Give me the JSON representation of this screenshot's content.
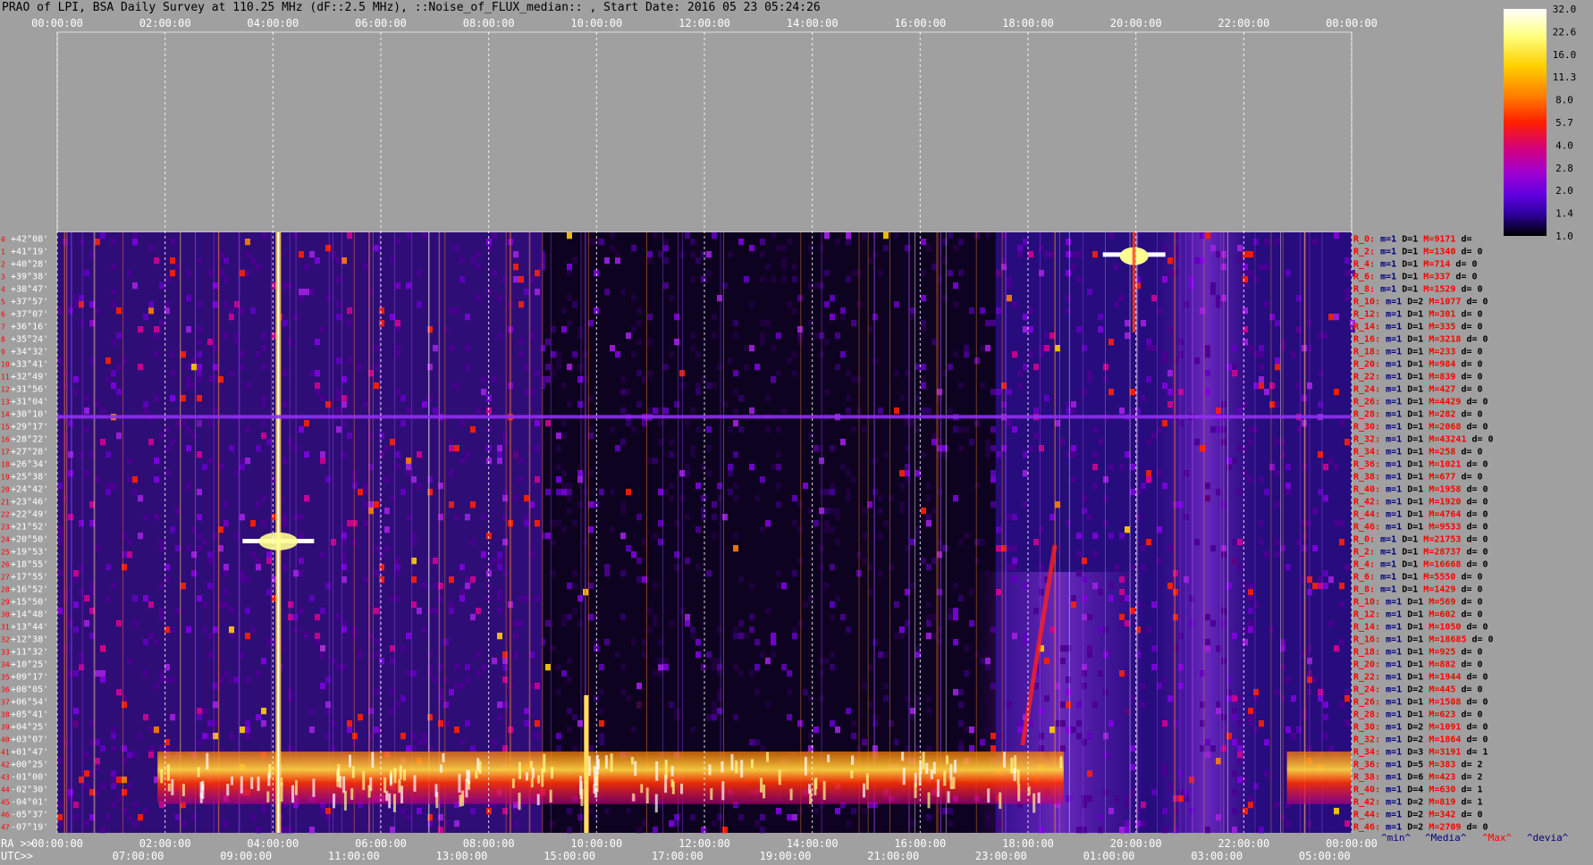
{
  "title": "PRAO of LPI, BSA Daily Survey at 110.25 MHz (dF::2.5 MHz), ::Noise_of_FLUX_median:: , Start Date: 2016 05 23 05:24:26",
  "chart_data": {
    "type": "heatmap",
    "title": "PRAO of LPI, BSA Daily Survey at 110.25 MHz (dF::2.5 MHz), ::Noise_of_FLUX_median:: , Start Date: 2016 05 23 05:24:26",
    "top_axis_ticks": [
      "00:00:00",
      "02:00:00",
      "04:00:00",
      "06:00:00",
      "08:00:00",
      "10:00:00",
      "12:00:00",
      "14:00:00",
      "16:00:00",
      "18:00:00",
      "20:00:00",
      "22:00:00",
      "00:00:00"
    ],
    "ra_prefix": "RA >>",
    "ra_ticks": [
      "00:00:00",
      "02:00:00",
      "04:00:00",
      "06:00:00",
      "08:00:00",
      "10:00:00",
      "12:00:00",
      "14:00:00",
      "16:00:00",
      "18:00:00",
      "20:00:00",
      "22:00:00",
      "00:00:00"
    ],
    "utc_prefix": "UTC>>",
    "utc_ticks": [
      "07:00:00",
      "09:00:00",
      "11:00:00",
      "13:00:00",
      "15:00:00",
      "17:00:00",
      "19:00:00",
      "21:00:00",
      "23:00:00",
      "01:00:00",
      "03:00:00",
      "05:00:00"
    ],
    "declinations": [
      "+42°08'",
      "+41°19'",
      "+40°28'",
      "+39°38'",
      "+38°47'",
      "+37°57'",
      "+37°07'",
      "+36°16'",
      "+35°24'",
      "+34°32'",
      "+33°41'",
      "+32°49'",
      "+31°56'",
      "+31°04'",
      "+30°10'",
      "+29°17'",
      "+28°22'",
      "+27°28'",
      "+26°34'",
      "+25°38'",
      "+24°42'",
      "+23°46'",
      "+22°49'",
      "+21°52'",
      "+20°50'",
      "+19°53'",
      "+18°55'",
      "+17°55'",
      "+16°52'",
      "+15°50'",
      "+14°48'",
      "+13°44'",
      "+12°38'",
      "+11°32'",
      "+10°25'",
      "+09°17'",
      "+08°05'",
      "+06°54'",
      "+05°41'",
      "+04°25'",
      "+03°07'",
      "+01°47'",
      "+00°25'",
      "-01°00'",
      "-02°30'",
      "-04°01'",
      "-05°37'",
      "-07°19'"
    ],
    "row_numbers": [
      "0",
      "1",
      "2",
      "3",
      "4",
      "5",
      "6",
      "7",
      "8",
      "9",
      "10",
      "11",
      "12",
      "13",
      "14",
      "15",
      "16",
      "17",
      "18",
      "19",
      "20",
      "21",
      "22",
      "23",
      "24",
      "25",
      "26",
      "27",
      "28",
      "29",
      "30",
      "31",
      "32",
      "33",
      "34",
      "35",
      "36",
      "37",
      "38",
      "39",
      "40",
      "41",
      "42",
      "43",
      "44",
      "45",
      "46",
      "47"
    ],
    "colorbar": {
      "scale": "log",
      "ticks": [
        "32.0",
        "22.6",
        "16.0",
        "11.3",
        "8.0",
        "5.7",
        "4.0",
        "2.8",
        "2.0",
        "1.4",
        "1.0"
      ],
      "colors": [
        "#ffffff",
        "#ffff80",
        "#ffd000",
        "#ff8000",
        "#ff2000",
        "#d00080",
        "#a000d0",
        "#7000f0",
        "#4000b0",
        "#180050",
        "#000000"
      ]
    },
    "stats": [
      {
        "r": "R_0:",
        "m": "m=1",
        "D": "D=1",
        "M": "M=9171",
        "d": "d="
      },
      {
        "r": "R_2:",
        "m": "m=1",
        "D": "D=1",
        "M": "M=1340",
        "d": "d= 0"
      },
      {
        "r": "R_4:",
        "m": "m=1",
        "D": "D=1",
        "M": "M=714",
        "d": "d= 0"
      },
      {
        "r": "R_6:",
        "m": "m=1",
        "D": "D=1",
        "M": "M=337",
        "d": "d= 0"
      },
      {
        "r": "R_8:",
        "m": "m=1",
        "D": "D=1",
        "M": "M=1529",
        "d": "d= 0"
      },
      {
        "r": "R_10:",
        "m": "m=1",
        "D": "D=2",
        "M": "M=1077",
        "d": "d= 0"
      },
      {
        "r": "R_12:",
        "m": "m=1",
        "D": "D=1",
        "M": "M=301",
        "d": "d= 0"
      },
      {
        "r": "R_14:",
        "m": "m=1",
        "D": "D=1",
        "M": "M=335",
        "d": "d= 0"
      },
      {
        "r": "R_16:",
        "m": "m=1",
        "D": "D=1",
        "M": "M=3218",
        "d": "d= 0"
      },
      {
        "r": "R_18:",
        "m": "m=1",
        "D": "D=1",
        "M": "M=233",
        "d": "d= 0"
      },
      {
        "r": "R_20:",
        "m": "m=1",
        "D": "D=1",
        "M": "M=984",
        "d": "d= 0"
      },
      {
        "r": "R_22:",
        "m": "m=1",
        "D": "D=1",
        "M": "M=839",
        "d": "d= 0"
      },
      {
        "r": "R_24:",
        "m": "m=1",
        "D": "D=1",
        "M": "M=427",
        "d": "d= 0"
      },
      {
        "r": "R_26:",
        "m": "m=1",
        "D": "D=1",
        "M": "M=4429",
        "d": "d= 0"
      },
      {
        "r": "R_28:",
        "m": "m=1",
        "D": "D=1",
        "M": "M=282",
        "d": "d= 0"
      },
      {
        "r": "R_30:",
        "m": "m=1",
        "D": "D=1",
        "M": "M=2068",
        "d": "d= 0"
      },
      {
        "r": "R_32:",
        "m": "m=1",
        "D": "D=1",
        "M": "M=43241",
        "d": "d= 0"
      },
      {
        "r": "R_34:",
        "m": "m=1",
        "D": "D=1",
        "M": "M=258",
        "d": "d= 0"
      },
      {
        "r": "R_36:",
        "m": "m=1",
        "D": "D=1",
        "M": "M=1021",
        "d": "d= 0"
      },
      {
        "r": "R_38:",
        "m": "m=1",
        "D": "D=1",
        "M": "M=677",
        "d": "d= 0"
      },
      {
        "r": "R_40:",
        "m": "m=1",
        "D": "D=1",
        "M": "M=1958",
        "d": "d= 0"
      },
      {
        "r": "R_42:",
        "m": "m=1",
        "D": "D=1",
        "M": "M=1920",
        "d": "d= 0"
      },
      {
        "r": "R_44:",
        "m": "m=1",
        "D": "D=1",
        "M": "M=4764",
        "d": "d= 0"
      },
      {
        "r": "R_46:",
        "m": "m=1",
        "D": "D=1",
        "M": "M=9533",
        "d": "d= 0"
      },
      {
        "r": "R_0:",
        "m": "m=1",
        "D": "D=1",
        "M": "M=21753",
        "d": "d= 0"
      },
      {
        "r": "R_2:",
        "m": "m=1",
        "D": "D=1",
        "M": "M=28737",
        "d": "d= 0"
      },
      {
        "r": "R_4:",
        "m": "m=1",
        "D": "D=1",
        "M": "M=16668",
        "d": "d= 0"
      },
      {
        "r": "R_6:",
        "m": "m=1",
        "D": "D=1",
        "M": "M=5550",
        "d": "d= 0"
      },
      {
        "r": "R_8:",
        "m": "m=1",
        "D": "D=1",
        "M": "M=1429",
        "d": "d= 0"
      },
      {
        "r": "R_10:",
        "m": "m=1",
        "D": "D=1",
        "M": "M=569",
        "d": "d= 0"
      },
      {
        "r": "R_12:",
        "m": "m=1",
        "D": "D=1",
        "M": "M=602",
        "d": "d= 0"
      },
      {
        "r": "R_14:",
        "m": "m=1",
        "D": "D=1",
        "M": "M=1050",
        "d": "d= 0"
      },
      {
        "r": "R_16:",
        "m": "m=1",
        "D": "D=1",
        "M": "M=18685",
        "d": "d= 0"
      },
      {
        "r": "R_18:",
        "m": "m=1",
        "D": "D=1",
        "M": "M=925",
        "d": "d= 0"
      },
      {
        "r": "R_20:",
        "m": "m=1",
        "D": "D=1",
        "M": "M=882",
        "d": "d= 0"
      },
      {
        "r": "R_22:",
        "m": "m=1",
        "D": "D=1",
        "M": "M=1944",
        "d": "d= 0"
      },
      {
        "r": "R_24:",
        "m": "m=1",
        "D": "D=2",
        "M": "M=445",
        "d": "d= 0"
      },
      {
        "r": "R_26:",
        "m": "m=1",
        "D": "D=1",
        "M": "M=1508",
        "d": "d= 0"
      },
      {
        "r": "R_28:",
        "m": "m=1",
        "D": "D=1",
        "M": "M=623",
        "d": "d= 0"
      },
      {
        "r": "R_30:",
        "m": "m=1",
        "D": "D=2",
        "M": "M=1091",
        "d": "d= 0"
      },
      {
        "r": "R_32:",
        "m": "m=1",
        "D": "D=2",
        "M": "M=1864",
        "d": "d= 0"
      },
      {
        "r": "R_34:",
        "m": "m=1",
        "D": "D=3",
        "M": "M=3191",
        "d": "d= 1"
      },
      {
        "r": "R_36:",
        "m": "m=1",
        "D": "D=5",
        "M": "M=383",
        "d": "d= 2"
      },
      {
        "r": "R_38:",
        "m": "m=1",
        "D": "D=6",
        "M": "M=423",
        "d": "d= 2"
      },
      {
        "r": "R_40:",
        "m": "m=1",
        "D": "D=4",
        "M": "M=630",
        "d": "d= 1"
      },
      {
        "r": "R_42:",
        "m": "m=1",
        "D": "D=2",
        "M": "M=819",
        "d": "d= 1"
      },
      {
        "r": "R_44:",
        "m": "m=1",
        "D": "D=2",
        "M": "M=342",
        "d": "d= 0"
      },
      {
        "r": "R_46:",
        "m": "m=1",
        "D": "D=2",
        "M": "M=2709",
        "d": "d= 0"
      }
    ],
    "stats_legend": [
      "^min^",
      "^Media^",
      "^Max^",
      "^devia^"
    ],
    "colors": {
      "background": "#a0a0a0",
      "stat_min": "#000080",
      "stat_max": "#ff0000",
      "row_number": "#ff0000",
      "plot_bg": "#12062c"
    }
  }
}
